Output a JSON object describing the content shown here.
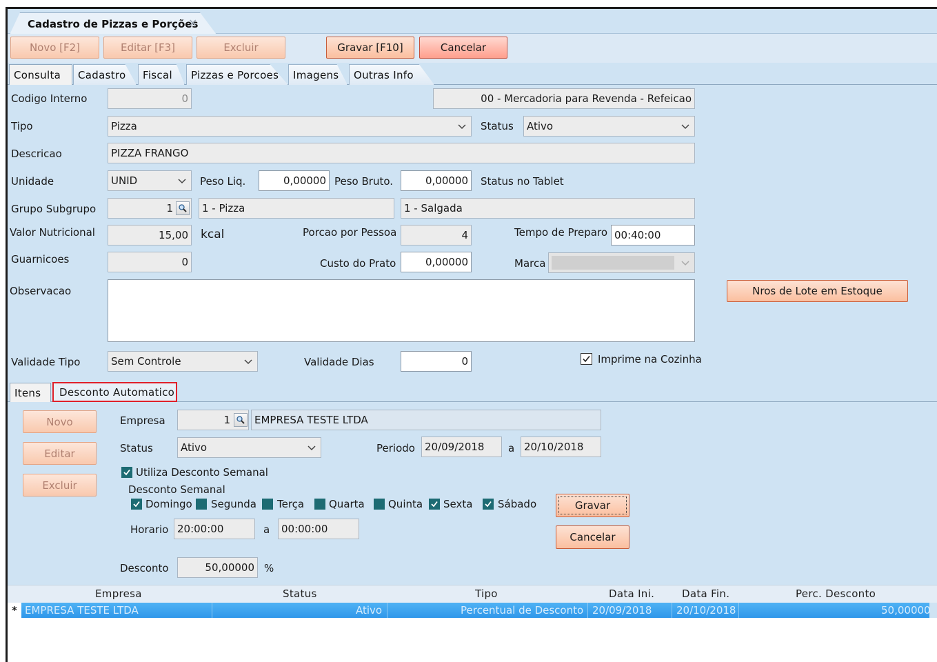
{
  "window": {
    "doc_tab_title": "Cadastro de Pizzas e Porções"
  },
  "toolbar": {
    "novo": "Novo [F2]",
    "editar": "Editar [F3]",
    "excluir": "Excluir",
    "gravar": "Gravar [F10]",
    "cancelar": "Cancelar"
  },
  "tabs": [
    "Consulta",
    "Cadastro",
    "Fiscal",
    "Pizzas e Porcoes",
    "Imagens",
    "Outras Info"
  ],
  "active_tab": "Consulta",
  "form": {
    "codigo_interno_label": "Codigo Interno",
    "codigo_interno_value": "0",
    "classificacao_value": "00 - Mercadoria para Revenda - Refeicao",
    "tipo_label": "Tipo",
    "tipo_value": "Pizza",
    "status_label": "Status",
    "status_value": "Ativo",
    "descricao_label": "Descricao",
    "descricao_value": "PIZZA FRANGO",
    "unidade_label": "Unidade",
    "unidade_value": "UNID",
    "peso_liq_label": "Peso Liq.",
    "peso_liq_value": "0,00000",
    "peso_bruto_label": "Peso Bruto.",
    "peso_bruto_value": "0,00000",
    "status_tablet_label": "Status no Tablet",
    "grupo_label": "Grupo Subgrupo",
    "grupo_code": "1",
    "grupo_name": "1 - Pizza",
    "subgrupo_name": "1 - Salgada",
    "valor_nutricional_label": "Valor Nutricional",
    "valor_nutricional_value": "15,00",
    "kcal_label": "kcal",
    "porcao_label": "Porcao por Pessoa",
    "porcao_value": "4",
    "tempo_preparo_label": "Tempo de Preparo",
    "tempo_preparo_value": "00:40:00",
    "guarnicoes_label": "Guarnicoes",
    "guarnicoes_value": "0",
    "custo_label": "Custo do Prato",
    "custo_value": "0,00000",
    "marca_label": "Marca",
    "observacao_label": "Observacao",
    "observacao_value": "",
    "nros_lote_button": "Nros de Lote em Estoque",
    "validade_tipo_label": "Validade Tipo",
    "validade_tipo_value": "Sem Controle",
    "validade_dias_label": "Validade Dias",
    "validade_dias_value": "0",
    "imprime_cozinha_label": "Imprime na Cozinha",
    "imprime_cozinha_checked": true
  },
  "subtabs": {
    "itens": "Itens",
    "desconto": "Desconto Automatico"
  },
  "desconto": {
    "novo": "Novo",
    "editar": "Editar",
    "excluir": "Excluir",
    "empresa_label": "Empresa",
    "empresa_code": "1",
    "empresa_name": "EMPRESA TESTE LTDA",
    "status_label": "Status",
    "status_value": "Ativo",
    "periodo_label": "Periodo",
    "periodo_ini": "20/09/2018",
    "periodo_a": "a",
    "periodo_fim": "20/10/2018",
    "utiliza_label": "Utiliza Desconto Semanal",
    "semanal_label": "Desconto Semanal",
    "dias": [
      {
        "label": "Domingo",
        "checked": true
      },
      {
        "label": "Segunda",
        "checked": false
      },
      {
        "label": "Terça",
        "checked": false
      },
      {
        "label": "Quarta",
        "checked": false
      },
      {
        "label": "Quinta",
        "checked": false
      },
      {
        "label": "Sexta",
        "checked": true
      },
      {
        "label": "Sábado",
        "checked": true
      }
    ],
    "horario_label": "Horario",
    "horario_ini": "20:00:00",
    "horario_a": "a",
    "horario_fim": "00:00:00",
    "desconto_label": "Desconto",
    "desconto_value": "50,00000",
    "percent_sign": "%",
    "gravar": "Gravar",
    "cancelar": "Cancelar"
  },
  "grid": {
    "columns": [
      "Empresa",
      "Status",
      "Tipo",
      "Data Ini.",
      "Data Fin.",
      "Perc. Desconto"
    ],
    "rows": [
      {
        "marker": "*",
        "empresa": "EMPRESA TESTE LTDA",
        "status": "Ativo",
        "tipo": "Percentual de Desconto",
        "data_ini": "20/09/2018",
        "data_fin": "20/10/2018",
        "perc": "50,00000"
      }
    ]
  },
  "colors": {
    "panel_bg": "#cfe3f3",
    "button_orange": "#fbbf9f",
    "highlight_red": "#e0202a",
    "row_selected": "#3aa2ee",
    "checkbox_teal": "#1d6b73"
  }
}
